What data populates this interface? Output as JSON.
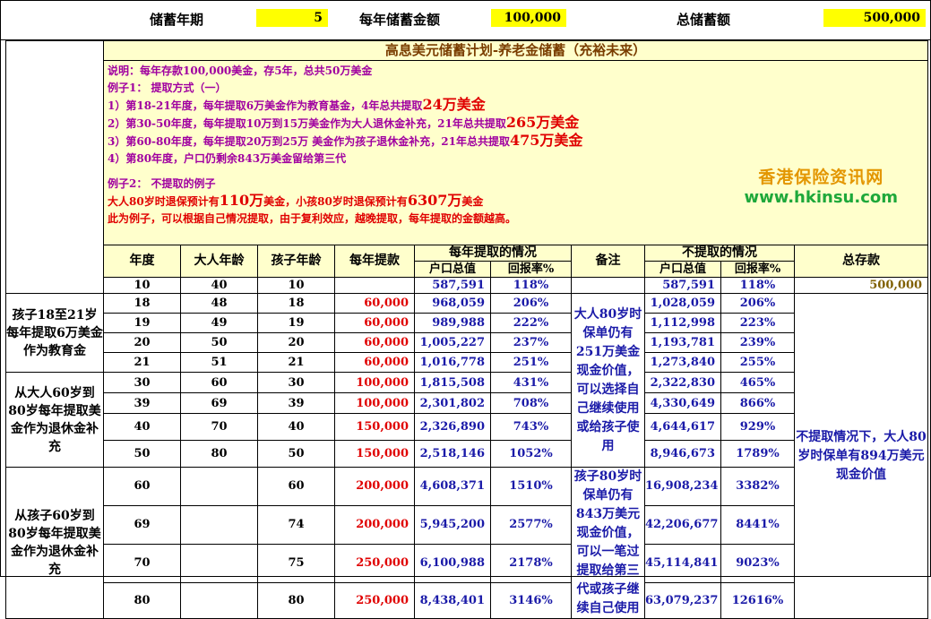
{
  "top": {
    "period_label": "储蓄年期",
    "period_value": "5",
    "annual_label": "每年储蓄金额",
    "annual_value": "100,000",
    "total_label": "总储蓄额",
    "total_value": "500,000"
  },
  "plan_title": "高息美元储蓄计划-养老金储蓄（充裕未来）",
  "intro": {
    "l1": "说明：每年存款100,000美金，存5年，总共50万美金",
    "l2": "例子1： 提取方式（一）",
    "l3a": "1）第18-21年度，每年提取6万美金作为教育基金，4年总共提取",
    "l3b": "24万美金",
    "l4a": "2）第30-50年度，每年提取10万到15万美金作为大人退休金补充，21年总共提取",
    "l4b": "265万美金",
    "l5a": "3）第60-80年度，每年提取20万到25万 美金作为孩子退休金补充，21年总共提取",
    "l5b": "475万美金",
    "l6": "4）第80年度，户口仍剩余843万美金留给第三代",
    "l7": "例子2： 不提取的例子",
    "l8a": "大人80岁时退保预计有",
    "l8b": "110万",
    "l8c": "美金，小孩80岁时退保预计有",
    "l8d": "6307万",
    "l8e": "美金",
    "l9": "此为例子，可以根据自己情况提取，由于复利效应，越晚提取，每年提取的金额越高。"
  },
  "watermark": {
    "line1": "香港保险资讯网",
    "line2": "www.hkinsu.com"
  },
  "headers": {
    "year": "年度",
    "adult_age": "大人年龄",
    "child_age": "孩子年龄",
    "withdraw": "每年提款",
    "with_group": "每年提取的情况",
    "acct": "户口总值",
    "rate": "回报率%",
    "remark": "备注",
    "without_group": "不提取的情况",
    "acct2": "户口总值",
    "rate2": "回报率%",
    "total": "总存款"
  },
  "row10": {
    "year": "10",
    "adult": "40",
    "child": "10",
    "acct": "587,591",
    "rate": "118%",
    "acct2": "587,591",
    "rate2": "118%",
    "total": "500,000"
  },
  "groups": {
    "g1": "孩子18至21岁每年提取6万美金作为教育金",
    "g2": "从大人60岁到80岁每年提取美金作为退休金补充",
    "g3": "从孩子60岁到80岁每年提取美金作为退休金补充"
  },
  "notes": {
    "n1": "大人80岁时保单仍有251万美金现金价值，可以选择自己继续使用或给孩子使用",
    "n2": "孩子80岁时保单仍有843万美元现金价值，可以一笔过提取给第三代或孩子继续自己使用",
    "total_note": "不提取情况下，大人80岁时保单有894万美元现金价值"
  },
  "rows": [
    {
      "year": "18",
      "adult": "48",
      "child": "18",
      "withdraw": "60,000",
      "acct": "968,059",
      "rate": "206%",
      "acct2": "1,028,059",
      "rate2": "206%"
    },
    {
      "year": "19",
      "adult": "49",
      "child": "19",
      "withdraw": "60,000",
      "acct": "989,988",
      "rate": "222%",
      "acct2": "1,112,998",
      "rate2": "223%"
    },
    {
      "year": "20",
      "adult": "50",
      "child": "20",
      "withdraw": "60,000",
      "acct": "1,005,227",
      "rate": "237%",
      "acct2": "1,193,781",
      "rate2": "239%"
    },
    {
      "year": "21",
      "adult": "51",
      "child": "21",
      "withdraw": "60,000",
      "acct": "1,016,778",
      "rate": "251%",
      "acct2": "1,273,840",
      "rate2": "255%"
    },
    {
      "year": "30",
      "adult": "60",
      "child": "30",
      "withdraw": "100,000",
      "acct": "1,815,508",
      "rate": "431%",
      "acct2": "2,322,830",
      "rate2": "465%"
    },
    {
      "year": "39",
      "adult": "69",
      "child": "39",
      "withdraw": "100,000",
      "acct": "2,301,802",
      "rate": "708%",
      "acct2": "4,330,649",
      "rate2": "866%"
    },
    {
      "year": "40",
      "adult": "70",
      "child": "40",
      "withdraw": "150,000",
      "acct": "2,326,890",
      "rate": "743%",
      "acct2": "4,644,617",
      "rate2": "929%"
    },
    {
      "year": "50",
      "adult": "80",
      "child": "50",
      "withdraw": "150,000",
      "acct": "2,518,146",
      "rate": "1052%",
      "acct2": "8,946,673",
      "rate2": "1789%"
    },
    {
      "year": "60",
      "adult": "",
      "child": "60",
      "withdraw": "200,000",
      "acct": "4,608,371",
      "rate": "1510%",
      "acct2": "16,908,234",
      "rate2": "3382%"
    },
    {
      "year": "69",
      "adult": "",
      "child": "74",
      "withdraw": "200,000",
      "acct": "5,945,200",
      "rate": "2577%",
      "acct2": "42,206,677",
      "rate2": "8441%"
    },
    {
      "year": "70",
      "adult": "",
      "child": "75",
      "withdraw": "250,000",
      "acct": "6,100,988",
      "rate": "2178%",
      "acct2": "45,114,841",
      "rate2": "9023%"
    },
    {
      "year": "80",
      "adult": "",
      "child": "80",
      "withdraw": "250,000",
      "acct": "8,438,401",
      "rate": "3146%",
      "acct2": "63,079,237",
      "rate2": "12616%"
    }
  ]
}
